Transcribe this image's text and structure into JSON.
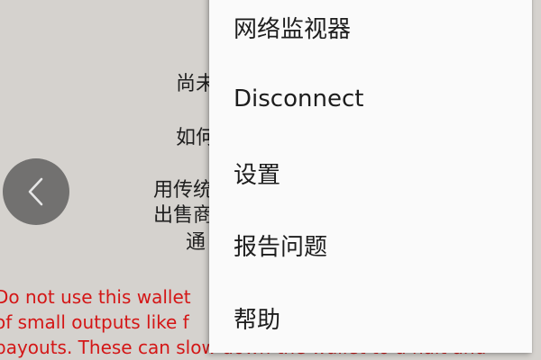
{
  "background": {
    "lines": [
      "尚未",
      "如何",
      "用传统",
      "出售商",
      "通"
    ],
    "warning_lines": [
      "Do not use this wallet",
      "of small outputs like f",
      "payouts. These can slow down the wallet to a halt and"
    ],
    "back_icon": "chevron-left-icon"
  },
  "menu": {
    "items": [
      {
        "label": "网络监视器"
      },
      {
        "label": "Disconnect"
      },
      {
        "label": "设置"
      },
      {
        "label": "报告问题"
      },
      {
        "label": "帮助"
      }
    ]
  },
  "colors": {
    "background": "#d5d2ce",
    "menu_background": "#fafafa",
    "warning_text": "#d41616",
    "nav_button": "#727170"
  }
}
